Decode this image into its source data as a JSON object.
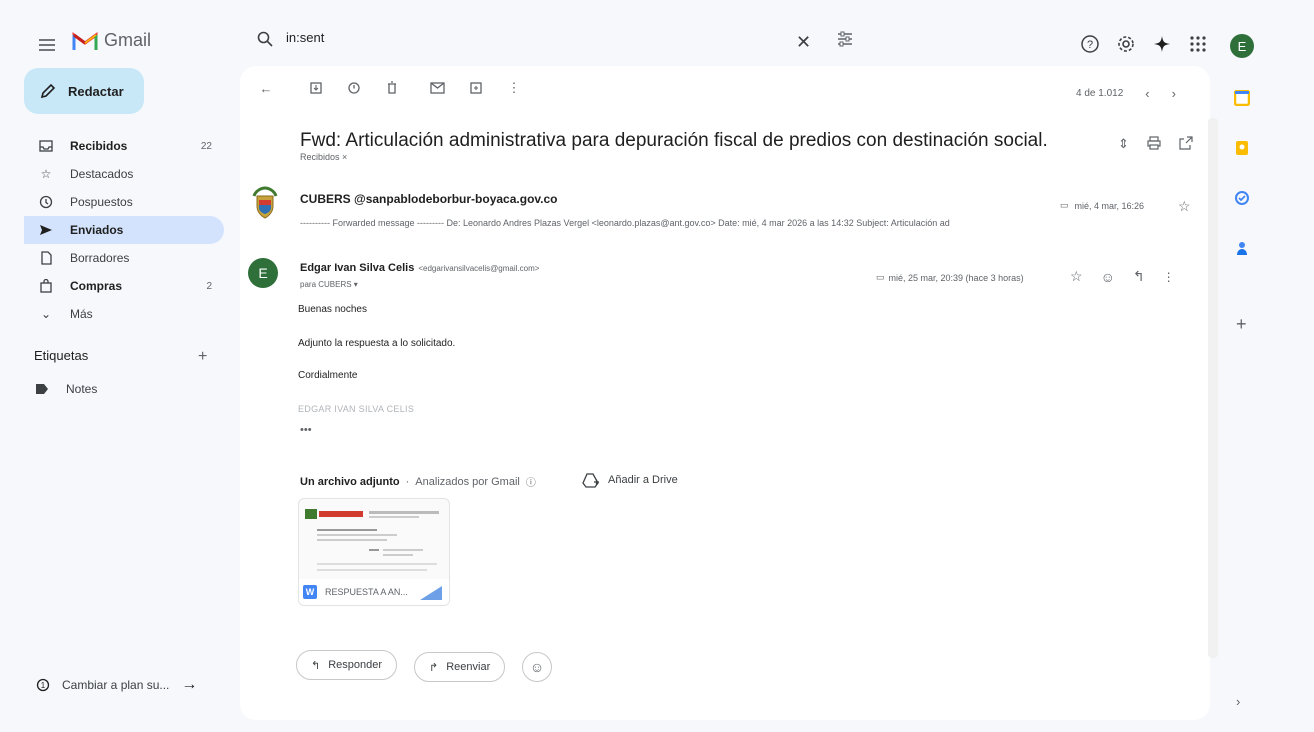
{
  "app": {
    "name": "Gmail"
  },
  "search": {
    "value": "in:sent"
  },
  "avatar_letter": "E",
  "compose": {
    "label": "Redactar"
  },
  "sidebar": {
    "items": [
      {
        "label": "Recibidos",
        "count": "22",
        "icon": "inbox-icon"
      },
      {
        "label": "Destacados",
        "count": "",
        "icon": "star-icon"
      },
      {
        "label": "Pospuestos",
        "count": "",
        "icon": "clock-icon"
      },
      {
        "label": "Enviados",
        "count": "",
        "icon": "send-icon"
      },
      {
        "label": "Borradores",
        "count": "",
        "icon": "draft-icon"
      },
      {
        "label": "Compras",
        "count": "2",
        "icon": "shopping-icon"
      },
      {
        "label": "Más",
        "count": "",
        "icon": "chevron-down-icon"
      }
    ],
    "labels_heading": "Etiquetas",
    "labels": [
      {
        "label": "Notes"
      }
    ],
    "upgrade": "Cambiar a plan su..."
  },
  "pager": {
    "text": "4 de 1.012"
  },
  "thread": {
    "subject": "Fwd: Articulación administrativa para depuración fiscal de predios con destinación social.",
    "label_chip": "Recibidos ×"
  },
  "message1": {
    "from": "CUBERS @sanpablodeborbur-boyaca.gov.co",
    "snippet": "---------- Forwarded message --------- De: Leonardo Andres Plazas Vergel <leonardo.plazas@ant.gov.co> Date: mié, 4 mar 2026 a las 14:32 Subject: Articulación ad",
    "date": "mié, 4 mar, 16:26"
  },
  "message2": {
    "avatar_letter": "E",
    "from_name": "Edgar Ivan Silva Celis",
    "from_email": "<edgarivansilvacelis@gmail.com>",
    "to": "para CUBERS ▾",
    "date": "mié, 25 mar, 20:39 (hace 3 horas)",
    "body": [
      "Buenas noches",
      "Adjunto la respuesta a lo solicitado.",
      "Cordialmente"
    ],
    "signature": "EDGAR IVAN SILVA CELIS",
    "ellipsis": "•••"
  },
  "attachments": {
    "heading": "Un archivo adjunto",
    "scanned": "Analizados por Gmail",
    "drive": "Añadir a Drive",
    "file_name": "RESPUESTA A AN..."
  },
  "actions": {
    "reply": "Responder",
    "forward": "Reenviar"
  },
  "colors": {
    "accent": "#c9e8f7",
    "active_nav": "#d3e3fd",
    "avatar": "#2f6f3a"
  }
}
